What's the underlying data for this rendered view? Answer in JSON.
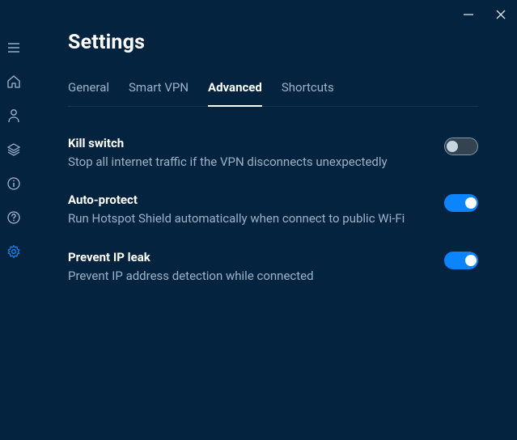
{
  "page_title": "Settings",
  "tabs": [
    {
      "label": "General",
      "active": false
    },
    {
      "label": "Smart VPN",
      "active": false
    },
    {
      "label": "Advanced",
      "active": true
    },
    {
      "label": "Shortcuts",
      "active": false
    }
  ],
  "settings": [
    {
      "title": "Kill switch",
      "desc": "Stop all internet traffic if the VPN disconnects unexpectedly",
      "on": false
    },
    {
      "title": "Auto-protect",
      "desc": "Run Hotspot Shield automatically when connect to public Wi-Fi",
      "on": true
    },
    {
      "title": "Prevent IP leak",
      "desc": "Prevent IP address detection while connected",
      "on": true
    }
  ],
  "sidebar": [
    {
      "name": "menu-icon"
    },
    {
      "name": "home-icon"
    },
    {
      "name": "account-icon"
    },
    {
      "name": "layers-icon"
    },
    {
      "name": "info-icon"
    },
    {
      "name": "help-icon"
    },
    {
      "name": "settings-icon",
      "active": true
    }
  ]
}
